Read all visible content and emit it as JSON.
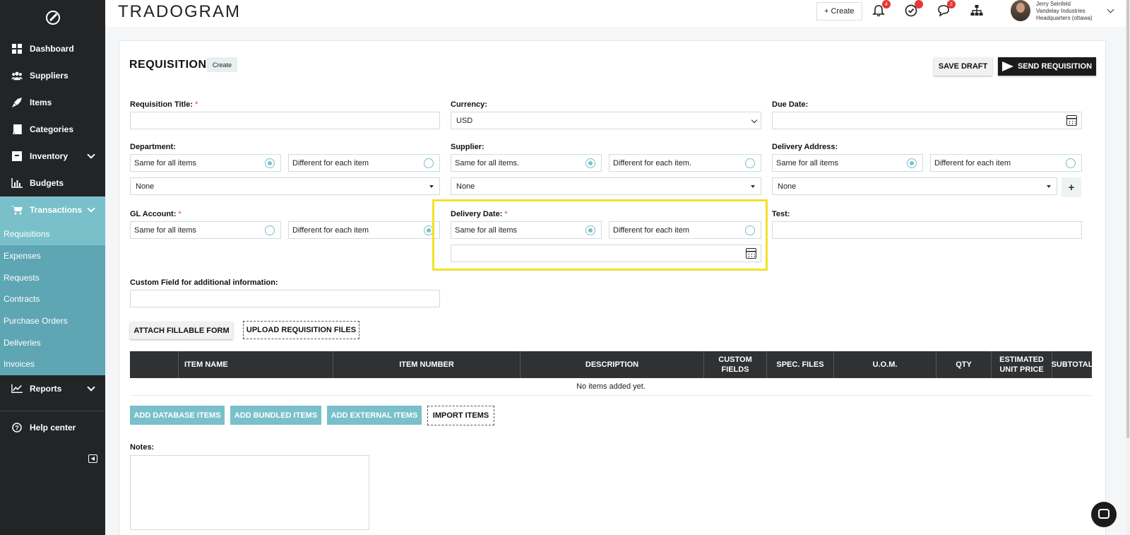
{
  "sidebar": {
    "items": [
      {
        "label": "Dashboard",
        "icon": "dashboard-icon"
      },
      {
        "label": "Suppliers",
        "icon": "users-icon"
      },
      {
        "label": "Items",
        "icon": "rocket-icon"
      },
      {
        "label": "Categories",
        "icon": "book-icon"
      },
      {
        "label": "Inventory",
        "icon": "box-icon"
      },
      {
        "label": "Budgets",
        "icon": "bar-chart-icon"
      }
    ],
    "transactions": {
      "label": "Transactions",
      "subitems": [
        "Requisitions",
        "Expenses",
        "Requests",
        "Contracts",
        "Purchase Orders",
        "Deliveries",
        "Invoices"
      ]
    },
    "reports_label": "Reports",
    "help_label": "Help center"
  },
  "topbar": {
    "brand": "TRADOGRAM",
    "create_label": "+  Create",
    "badges": {
      "notifications": "4",
      "tasks": "",
      "messages": "2"
    },
    "user": {
      "name": "Jerry Seinfeld",
      "company": "Vandelay Industries",
      "location": "Headquarters (ottawa)"
    }
  },
  "page": {
    "title": "REQUISITION",
    "title_badge": "Create",
    "save_draft": "SAVE DRAFT",
    "send": "SEND REQUISITION"
  },
  "form": {
    "requisition_title": {
      "label": "Requisition Title:",
      "required": "*",
      "value": ""
    },
    "currency": {
      "label": "Currency:",
      "value": "USD"
    },
    "due_date": {
      "label": "Due Date:",
      "value": ""
    },
    "department": {
      "label": "Department:",
      "same": "Same for all items",
      "different": "Different for each item",
      "select": "None"
    },
    "supplier": {
      "label": "Supplier:",
      "same": "Same for all items.",
      "different": "Different for each item.",
      "select": "None"
    },
    "delivery_address": {
      "label": "Delivery Address:",
      "same": "Same for all items",
      "different": "Different for each item",
      "select": "None",
      "add": "+"
    },
    "gl_account": {
      "label": "GL Account:",
      "required": "*",
      "same": "Same for all items",
      "different": "Different for each item"
    },
    "delivery_date": {
      "label": "Delivery Date:",
      "required": "*",
      "same": "Same for all items",
      "different": "Different for each item",
      "value": ""
    },
    "test": {
      "label": "Test:",
      "value": ""
    },
    "custom_field": {
      "label": "Custom Field for additional information:",
      "value": ""
    },
    "notes": {
      "label": "Notes:",
      "value": ""
    }
  },
  "actions": {
    "attach_form": "ATTACH FILLABLE FORM",
    "upload_files": "UPLOAD REQUISITION FILES",
    "add_database": "ADD DATABASE ITEMS",
    "add_bundled": "ADD BUNDLED ITEMS",
    "add_external": "ADD EXTERNAL ITEMS",
    "import_items": "IMPORT ITEMS"
  },
  "table": {
    "columns": [
      "ITEM NAME",
      "ITEM NUMBER",
      "DESCRIPTION",
      "CUSTOM FIELDS",
      "SPEC. FILES",
      "U.O.M.",
      "QTY",
      "ESTIMATED UNIT PRICE",
      "SUBTOTAL"
    ],
    "empty": "No items added yet."
  },
  "colors": {
    "accent": "#79c0ca",
    "sidebar": "#222426",
    "highlight": "#f2e12a",
    "dark_button": "#1b1b1b"
  }
}
